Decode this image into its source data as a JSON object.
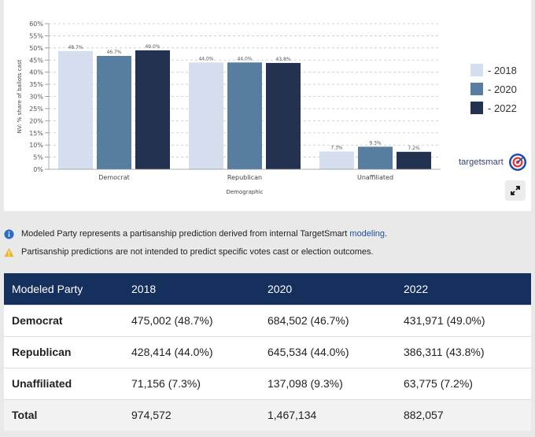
{
  "chart_data": {
    "type": "bar",
    "title": "",
    "xlabel": "Demographic",
    "ylabel": "NV: % share of ballots cast",
    "ylim": [
      0,
      60
    ],
    "yticks": [
      "0%",
      "5%",
      "10%",
      "15%",
      "20%",
      "25%",
      "30%",
      "35%",
      "40%",
      "45%",
      "50%",
      "55%",
      "60%"
    ],
    "categories": [
      "Democrat",
      "Republican",
      "Unaffiliated"
    ],
    "grid": "horizontal dashed",
    "legend_position": "right",
    "series": [
      {
        "name": "- 2018",
        "color": "#d4deef",
        "values": [
          48.7,
          44.0,
          7.3
        ],
        "labels": [
          "48.7%",
          "44.0%",
          "7.3%"
        ]
      },
      {
        "name": "- 2020",
        "color": "#577da0",
        "values": [
          46.7,
          44.0,
          9.3
        ],
        "labels": [
          "46.7%",
          "44.0%",
          "9.3%"
        ]
      },
      {
        "name": "- 2022",
        "color": "#233250",
        "values": [
          49.0,
          43.8,
          7.2
        ],
        "labels": [
          "49.0%",
          "43.8%",
          "7.2%"
        ]
      }
    ]
  },
  "brand": {
    "name_part1": "target",
    "name_part2": "smart",
    "logo_icon": "target-bullseye-icon"
  },
  "expand_icon": "expand-arrows-icon",
  "notes": [
    {
      "icon": "info-icon",
      "color": "#2b6cc4",
      "text": "Modeled Party represents a partisanship prediction derived from internal TargetSmart ",
      "link": "modeling",
      "suffix": "."
    },
    {
      "icon": "warning-icon",
      "color": "#f0b429",
      "text": "Partisanship predictions are not intended to predict specific votes cast or election outcomes.",
      "link": "",
      "suffix": ""
    }
  ],
  "table": {
    "header_color": "#16305e",
    "columns": [
      "Modeled Party",
      "2018",
      "2020",
      "2022"
    ],
    "rows": [
      [
        "Democrat",
        "475,002 (48.7%)",
        "684,502 (46.7%)",
        "431,971 (49.0%)"
      ],
      [
        "Republican",
        "428,414 (44.0%)",
        "645,534 (44.0%)",
        "386,311 (43.8%)"
      ],
      [
        "Unaffiliated",
        "71,156 (7.3%)",
        "137,098 (9.3%)",
        "63,775 (7.2%)"
      ],
      [
        "Total",
        "974,572",
        "1,467,134",
        "882,057"
      ]
    ]
  }
}
